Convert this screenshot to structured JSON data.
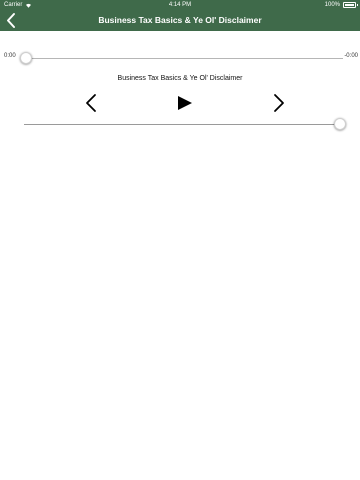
{
  "status_bar": {
    "carrier": "Carrier",
    "time": "4:14 PM",
    "battery": "100%"
  },
  "nav": {
    "title": "Business Tax Basics & Ye Ol' Disclaimer"
  },
  "player": {
    "elapsed": "0:00",
    "remaining": "-0:00",
    "progress": 0,
    "track_title": "Business Tax Basics & Ye Ol' Disclaimer",
    "volume": 1.0
  },
  "colors": {
    "header_bg": "#3f6a4a",
    "accent": "#3478f6"
  }
}
